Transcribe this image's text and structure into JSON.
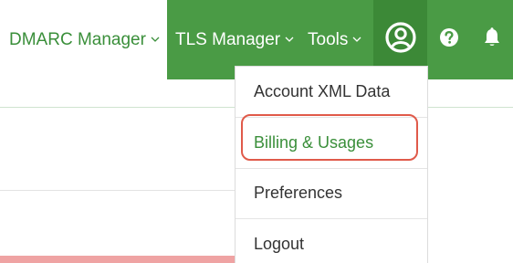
{
  "nav": {
    "dmarc_label": "DMARC Manager",
    "tls_label": "TLS Manager",
    "tools_label": "Tools",
    "account_icon": "account-circle-icon",
    "help_icon": "help-circle-icon",
    "bell_icon": "bell-icon"
  },
  "account_menu": {
    "items": [
      {
        "label": "Account XML Data"
      },
      {
        "label": "Billing & Usages",
        "active": true,
        "highlighted": true
      },
      {
        "label": "Preferences"
      },
      {
        "label": "Logout"
      }
    ]
  },
  "colors": {
    "brand_green": "#4a9b45",
    "link_green": "#3a8f3a",
    "highlight_red": "#e05a4a",
    "alert_pink": "#efa3a3"
  }
}
